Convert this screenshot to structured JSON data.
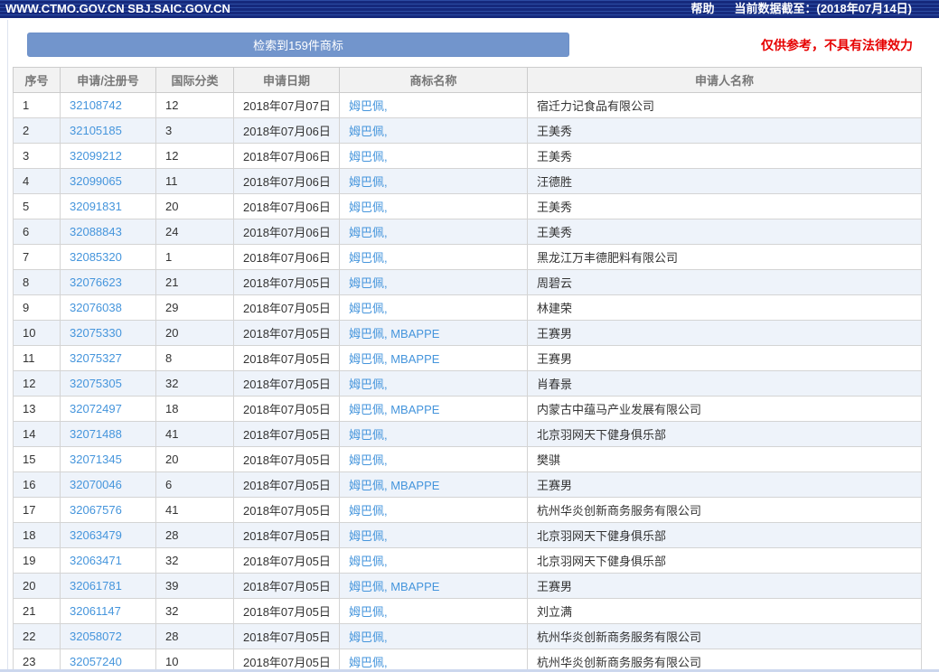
{
  "topbar": {
    "site": "WWW.CTMO.GOV.CN SBJ.SAIC.GOV.CN",
    "help": "帮助",
    "cutoff": "当前数据截至：(2018年07月14日)"
  },
  "toolbar": {
    "results": "检索到159件商标",
    "disclaimer": "仅供参考，不具有法律效力"
  },
  "colors": {
    "topbar_bg": "#15297c",
    "button_bg": "#7295cc",
    "link_blue": "#4595dc",
    "disclaimer_red": "#e60000",
    "even_row_bg": "#eef3fa"
  },
  "table": {
    "columns": [
      "序号",
      "申请/注册号",
      "国际分类",
      "申请日期",
      "商标名称",
      "申请人名称"
    ],
    "rows": [
      {
        "no": "1",
        "reg": "32108742",
        "cls": "12",
        "date": "2018年07月07日",
        "mark": "姆巴佩,",
        "applicant": "宿迁力记食品有限公司"
      },
      {
        "no": "2",
        "reg": "32105185",
        "cls": "3",
        "date": "2018年07月06日",
        "mark": "姆巴佩,",
        "applicant": "王美秀"
      },
      {
        "no": "3",
        "reg": "32099212",
        "cls": "12",
        "date": "2018年07月06日",
        "mark": "姆巴佩,",
        "applicant": "王美秀"
      },
      {
        "no": "4",
        "reg": "32099065",
        "cls": "11",
        "date": "2018年07月06日",
        "mark": "姆巴佩,",
        "applicant": "汪德胜"
      },
      {
        "no": "5",
        "reg": "32091831",
        "cls": "20",
        "date": "2018年07月06日",
        "mark": "姆巴佩,",
        "applicant": "王美秀"
      },
      {
        "no": "6",
        "reg": "32088843",
        "cls": "24",
        "date": "2018年07月06日",
        "mark": "姆巴佩,",
        "applicant": "王美秀"
      },
      {
        "no": "7",
        "reg": "32085320",
        "cls": "1",
        "date": "2018年07月06日",
        "mark": "姆巴佩,",
        "applicant": "黑龙江万丰德肥料有限公司"
      },
      {
        "no": "8",
        "reg": "32076623",
        "cls": "21",
        "date": "2018年07月05日",
        "mark": "姆巴佩,",
        "applicant": "周碧云"
      },
      {
        "no": "9",
        "reg": "32076038",
        "cls": "29",
        "date": "2018年07月05日",
        "mark": "姆巴佩,",
        "applicant": "林建荣"
      },
      {
        "no": "10",
        "reg": "32075330",
        "cls": "20",
        "date": "2018年07月05日",
        "mark": "姆巴佩, MBAPPE",
        "applicant": "王赛男"
      },
      {
        "no": "11",
        "reg": "32075327",
        "cls": "8",
        "date": "2018年07月05日",
        "mark": "姆巴佩, MBAPPE",
        "applicant": "王赛男"
      },
      {
        "no": "12",
        "reg": "32075305",
        "cls": "32",
        "date": "2018年07月05日",
        "mark": "姆巴佩,",
        "applicant": "肖春景"
      },
      {
        "no": "13",
        "reg": "32072497",
        "cls": "18",
        "date": "2018年07月05日",
        "mark": "姆巴佩, MBAPPE",
        "applicant": "内蒙古中蕴马产业发展有限公司"
      },
      {
        "no": "14",
        "reg": "32071488",
        "cls": "41",
        "date": "2018年07月05日",
        "mark": "姆巴佩,",
        "applicant": "北京羽网天下健身俱乐部"
      },
      {
        "no": "15",
        "reg": "32071345",
        "cls": "20",
        "date": "2018年07月05日",
        "mark": "姆巴佩,",
        "applicant": "樊骐"
      },
      {
        "no": "16",
        "reg": "32070046",
        "cls": "6",
        "date": "2018年07月05日",
        "mark": "姆巴佩, MBAPPE",
        "applicant": "王赛男"
      },
      {
        "no": "17",
        "reg": "32067576",
        "cls": "41",
        "date": "2018年07月05日",
        "mark": "姆巴佩,",
        "applicant": "杭州华炎创新商务服务有限公司"
      },
      {
        "no": "18",
        "reg": "32063479",
        "cls": "28",
        "date": "2018年07月05日",
        "mark": "姆巴佩,",
        "applicant": "北京羽网天下健身俱乐部"
      },
      {
        "no": "19",
        "reg": "32063471",
        "cls": "32",
        "date": "2018年07月05日",
        "mark": "姆巴佩,",
        "applicant": "北京羽网天下健身俱乐部"
      },
      {
        "no": "20",
        "reg": "32061781",
        "cls": "39",
        "date": "2018年07月05日",
        "mark": "姆巴佩, MBAPPE",
        "applicant": "王赛男"
      },
      {
        "no": "21",
        "reg": "32061147",
        "cls": "32",
        "date": "2018年07月05日",
        "mark": "姆巴佩,",
        "applicant": "刘立满"
      },
      {
        "no": "22",
        "reg": "32058072",
        "cls": "28",
        "date": "2018年07月05日",
        "mark": "姆巴佩,",
        "applicant": "杭州华炎创新商务服务有限公司"
      },
      {
        "no": "23",
        "reg": "32057240",
        "cls": "10",
        "date": "2018年07月05日",
        "mark": "姆巴佩,",
        "applicant": "杭州华炎创新商务服务有限公司"
      }
    ]
  }
}
